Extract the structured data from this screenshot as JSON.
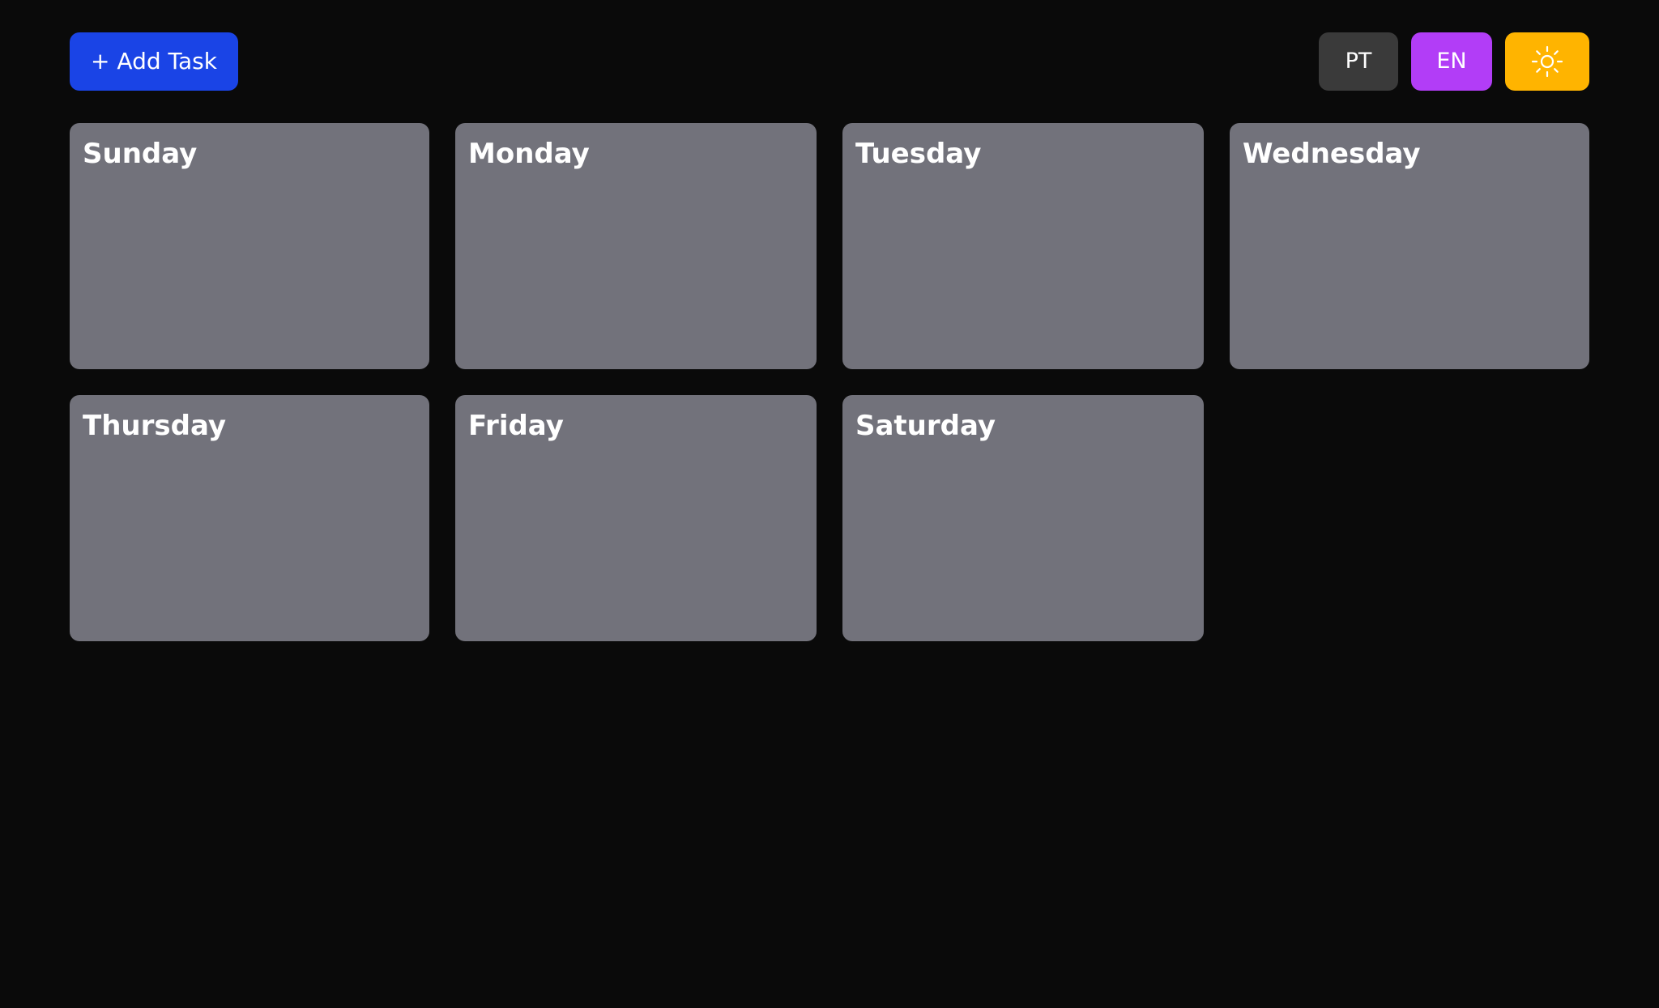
{
  "header": {
    "add_task_label": "+ Add Task",
    "languages": [
      {
        "label": "PT",
        "color": "#3a3a3a"
      },
      {
        "label": "EN",
        "color": "#b23df7"
      }
    ],
    "theme_toggle_icon": "sun-icon",
    "theme_toggle_color": "#ffb400",
    "add_task_color": "#1a44e6"
  },
  "days": [
    {
      "label": "Sunday"
    },
    {
      "label": "Monday"
    },
    {
      "label": "Tuesday"
    },
    {
      "label": "Wednesday"
    },
    {
      "label": "Thursday"
    },
    {
      "label": "Friday"
    },
    {
      "label": "Saturday"
    }
  ],
  "colors": {
    "background": "#0a0a0a",
    "card": "#72727b",
    "text": "#ffffff"
  }
}
